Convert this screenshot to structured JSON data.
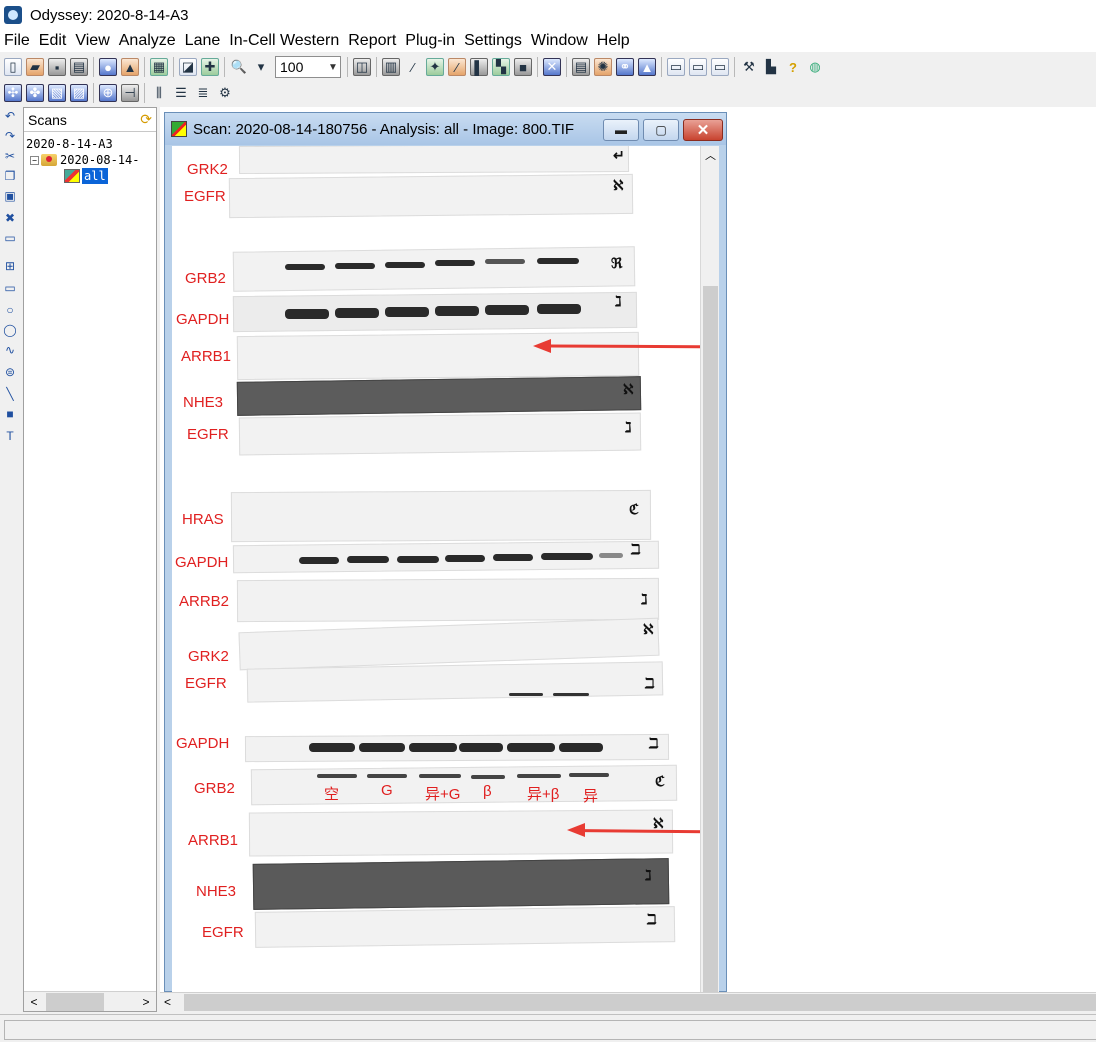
{
  "app": {
    "title": "Odyssey: 2020-8-14-A3"
  },
  "menu": [
    "File",
    "Edit",
    "View",
    "Analyze",
    "Lane",
    "In-Cell Western",
    "Report",
    "Plug-in",
    "Settings",
    "Window",
    "Help"
  ],
  "toolbar": {
    "zoom_value": "100"
  },
  "scans": {
    "header": "Scans",
    "tree": {
      "root": "2020-8-14-A3",
      "scan": "2020-08-14-",
      "analysis": "all"
    }
  },
  "child": {
    "title": "Scan: 2020-08-14-180756 - Analysis: all - Image: 800.TIF"
  },
  "blot": {
    "labels": [
      "GRK2",
      "EGFR",
      "GRB2",
      "GAPDH",
      "ARRB1",
      "NHE3",
      "EGFR",
      "HRAS",
      "GAPDH",
      "ARRB2",
      "GRK2",
      "EGFR",
      "GAPDH",
      "GRB2",
      "ARRB1",
      "NHE3",
      "EGFR"
    ],
    "lane_labels": [
      "空",
      "G",
      "异+G",
      "β",
      "异+β",
      "异"
    ]
  },
  "colors": {
    "annotation": "#e02020",
    "arrow": "#e83b33",
    "selection": "#0a64d8"
  }
}
